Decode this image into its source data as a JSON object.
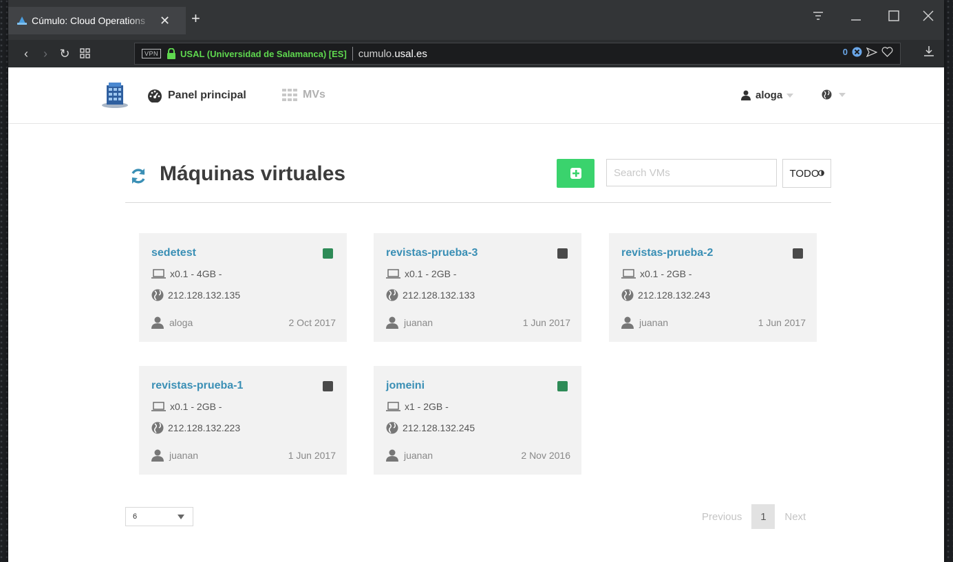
{
  "browser": {
    "tab_title": "Cúmulo: Cloud Operations",
    "new_tab": "+",
    "cert_label": "USAL (Universidad de Salamanca) [ES]",
    "vpn_label": "VPN",
    "url_prefix": "cumulo.",
    "url_domain": "usal.es",
    "block_count": "0"
  },
  "nav": {
    "panel_label": "Panel principal",
    "mvs_label": "MVs",
    "user": "aloga"
  },
  "main": {
    "title": "Máquinas virtuales",
    "search_placeholder": "Search VMs",
    "filter_label": "TODO"
  },
  "colors": {
    "status_running": "#2e8b57",
    "status_stopped": "#4a4a4a",
    "accent_green": "#3ad36d",
    "vm_link": "#3a8fb5"
  },
  "vms": [
    {
      "name": "sedetest",
      "specs": "x0.1 - 4GB -",
      "ip": "212.128.132.135",
      "owner": "aloga",
      "date": "2 Oct 2017",
      "status": "running"
    },
    {
      "name": "revistas-prueba-3",
      "specs": "x0.1 - 2GB -",
      "ip": "212.128.132.133",
      "owner": "juanan",
      "date": "1 Jun 2017",
      "status": "stopped"
    },
    {
      "name": "revistas-prueba-2",
      "specs": "x0.1 - 2GB -",
      "ip": "212.128.132.243",
      "owner": "juanan",
      "date": "1 Jun 2017",
      "status": "stopped"
    },
    {
      "name": "revistas-prueba-1",
      "specs": "x0.1 - 2GB -",
      "ip": "212.128.132.223",
      "owner": "juanan",
      "date": "1 Jun 2017",
      "status": "stopped"
    },
    {
      "name": "jomeini",
      "specs": "x1 - 2GB -",
      "ip": "212.128.132.245",
      "owner": "juanan",
      "date": "2 Nov 2016",
      "status": "running"
    }
  ],
  "pagination": {
    "page_size": "6",
    "previous": "Previous",
    "current": "1",
    "next": "Next"
  }
}
